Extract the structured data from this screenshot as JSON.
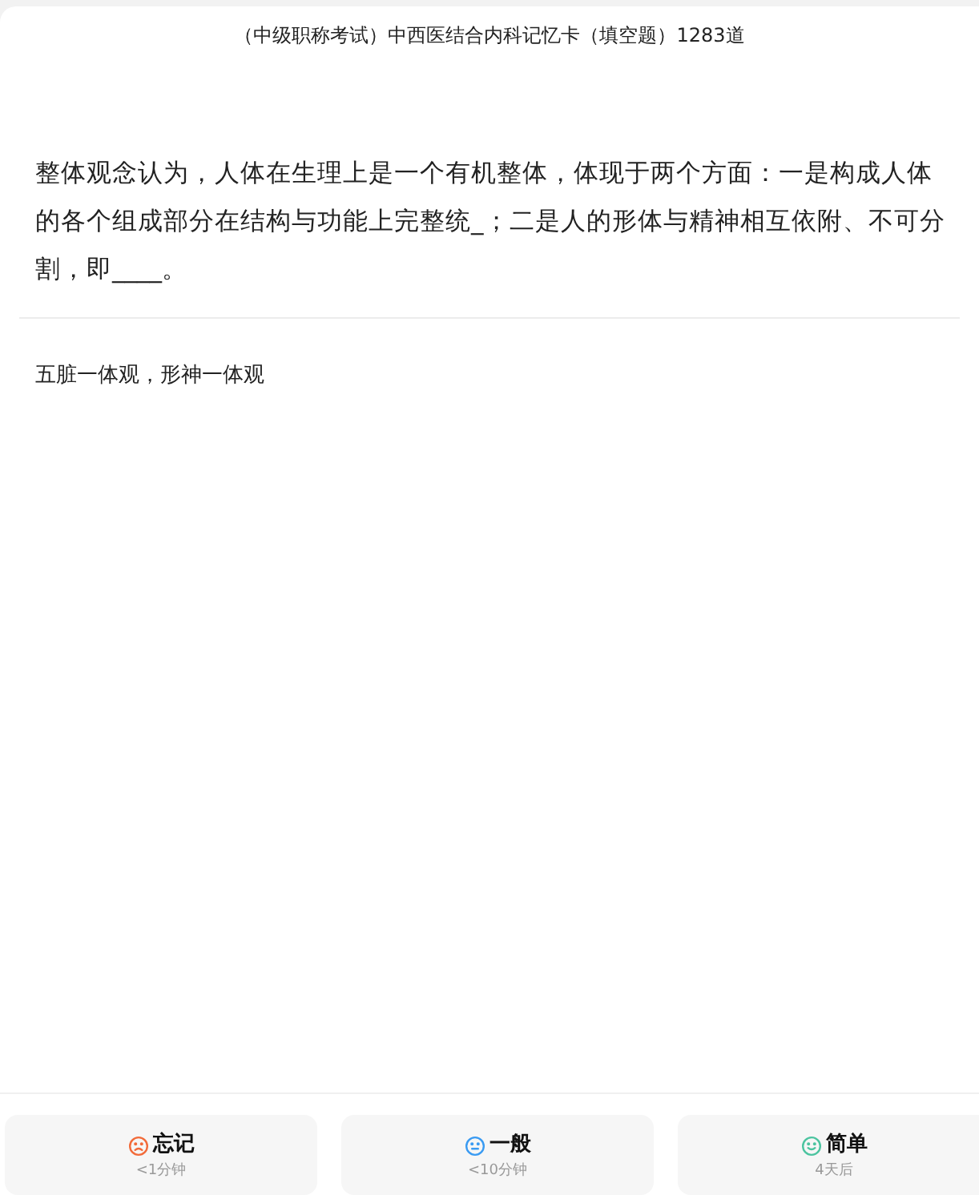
{
  "header": {
    "title": "（中级职称考试）中西医结合内科记忆卡（填空题）1283道"
  },
  "card": {
    "question": "整体观念认为，人体在生理上是一个有机整体，体现于两个方面：一是构成人体的各个组成部分在结构与功能上完整统_；二是人的形体与精神相互依附、不可分割，即____。",
    "answer": "五脏一体观，形神一体观"
  },
  "buttons": [
    {
      "kind": "sad",
      "color": "#f26b3a",
      "label": "忘记",
      "interval": "<1分钟"
    },
    {
      "kind": "neutral",
      "color": "#3a9bf2",
      "label": "一般",
      "interval": "<10分钟"
    },
    {
      "kind": "happy",
      "color": "#4cc4a0",
      "label": "简单",
      "interval": "4天后"
    }
  ]
}
